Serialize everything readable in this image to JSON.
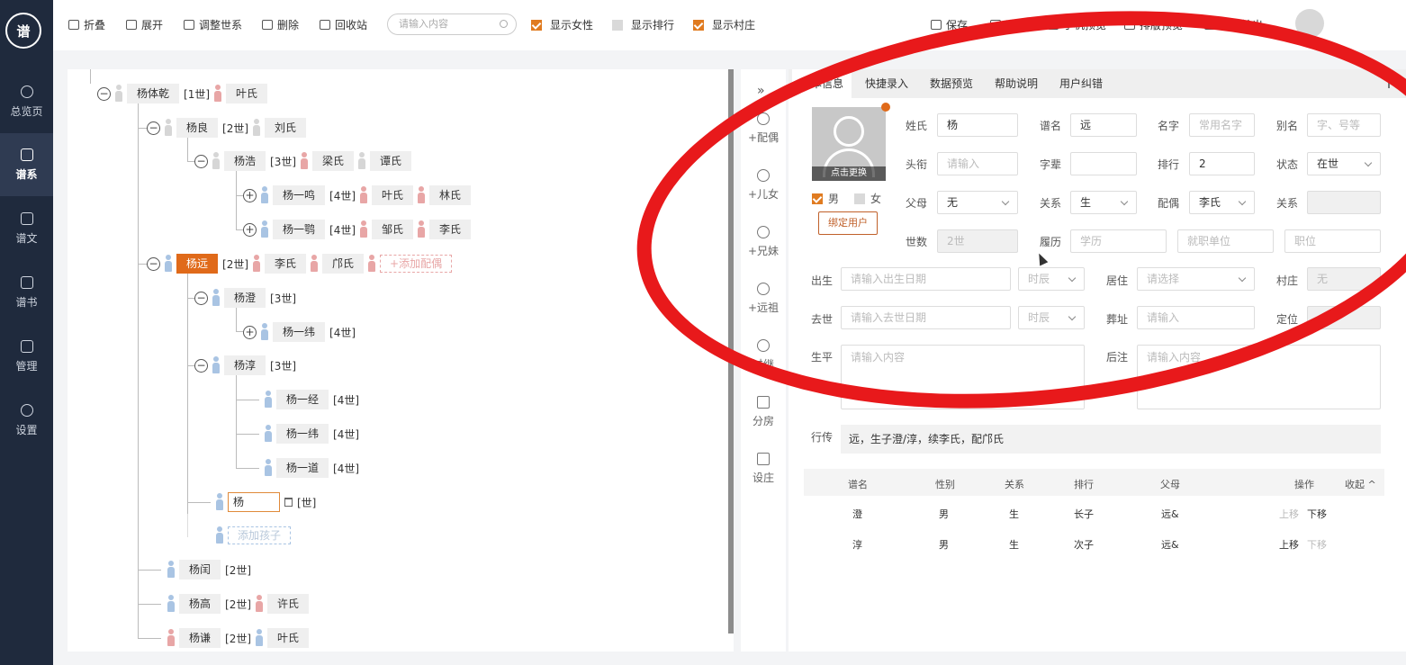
{
  "sidebar": {
    "logo": "谱",
    "items": [
      {
        "label": "总览页"
      },
      {
        "label": "谱系"
      },
      {
        "label": "谱文"
      },
      {
        "label": "谱书"
      },
      {
        "label": "管理"
      },
      {
        "label": "设置"
      }
    ]
  },
  "toolbar": {
    "collapse": "折叠",
    "expand": "展开",
    "adjust": "调整世系",
    "delete": "删除",
    "recycle": "回收站",
    "search_placeholder": "请输入内容",
    "show_female": "显示女性",
    "show_rank": "显示排行",
    "show_village": "显示村庄",
    "save": "保存",
    "font": "造字",
    "mobile_preview": "手机预览",
    "layout_preview": "排版预览",
    "export": "选版输出"
  },
  "tree": {
    "root": {
      "name": "杨体乾",
      "gen": "[1世]",
      "spouse": "叶氏"
    },
    "liang": {
      "name": "杨良",
      "gen": "[2世]",
      "spouse": "刘氏"
    },
    "hao": {
      "name": "杨浩",
      "gen": "[3世]",
      "spouse1": "梁氏",
      "spouse2": "谭氏"
    },
    "yiming": {
      "name": "杨一鸣",
      "gen": "[4世]",
      "spouse1": "叶氏",
      "spouse2": "林氏"
    },
    "yipeng": {
      "name": "杨一鹗",
      "gen": "[4世]",
      "spouse1": "邹氏",
      "spouse2": "李氏"
    },
    "yuan": {
      "name": "杨远",
      "gen": "[2世]",
      "spouse1": "李氏",
      "spouse2": "邝氏",
      "add_spouse": "+添加配偶"
    },
    "cheng": {
      "name": "杨澄",
      "gen": "[3世]"
    },
    "yiwei1": {
      "name": "杨一纬",
      "gen": "[4世]"
    },
    "chun": {
      "name": "杨淳",
      "gen": "[3世]"
    },
    "yijing": {
      "name": "杨一经",
      "gen": "[4世]"
    },
    "yiwei2": {
      "name": "杨一纬",
      "gen": "[4世]"
    },
    "yidao": {
      "name": "杨一道",
      "gen": "[4世]"
    },
    "new_child": {
      "value": "杨",
      "gen": "[世]"
    },
    "add_child": "添加孩子",
    "run": {
      "name": "杨闰",
      "gen": "[2世]"
    },
    "gao": {
      "name": "杨高",
      "gen": "[2世]",
      "spouse": "许氏"
    },
    "qian": {
      "name": "杨谦",
      "gen": "[2世]",
      "spouse": "叶氏"
    }
  },
  "mid_nav": [
    {
      "label": "+配偶"
    },
    {
      "label": "+儿女"
    },
    {
      "label": "+兄妹"
    },
    {
      "label": "+远祖"
    },
    {
      "label": "过继"
    },
    {
      "label": "分房"
    },
    {
      "label": "设庄"
    }
  ],
  "tabs": [
    "基本信息",
    "快捷录入",
    "数据预览",
    "帮助说明",
    "用户纠错"
  ],
  "form": {
    "photo_caption": "点击更换",
    "gender_male": "男",
    "gender_female": "女",
    "bind_user": "绑定用户",
    "surname_label": "姓氏",
    "surname": "杨",
    "puming_label": "谱名",
    "puming": "远",
    "mingzi_label": "名字",
    "mingzi_ph": "常用名字",
    "bieming_label": "别名",
    "bieming_ph": "字、号等",
    "touxian_label": "头衔",
    "touxian_ph": "请输入",
    "zibei_label": "字辈",
    "zibei": "",
    "paihang_label": "排行",
    "paihang": "2",
    "zhuangtai_label": "状态",
    "zhuangtai": "在世",
    "fumu_label": "父母",
    "fumu": "无",
    "guanxi_label": "关系",
    "guanxi": "生",
    "peiou_label": "配偶",
    "peiou": "李氏",
    "guanxi2_label": "关系",
    "shishu_label": "世数",
    "shishu": "2世",
    "luli_label": "履历",
    "xueli_ph": "学历",
    "danwei_ph": "就职单位",
    "zhiwei_ph": "职位",
    "chusheng_label": "出生",
    "chusheng_ph": "请输入出生日期",
    "shichen_ph": "时辰",
    "juzhu_label": "居住",
    "juzhu_ph": "请选择",
    "cunzhuang_label": "村庄",
    "cunzhuang": "无",
    "qushi_label": "去世",
    "qushi_ph": "请输入去世日期",
    "shichen2_ph": "时辰",
    "zangzhi_label": "葬址",
    "zangzhi_ph": "请输入",
    "dingwei_label": "定位",
    "shengping_label": "生平",
    "shengping_ph": "请输入内容",
    "houzhu_label": "后注",
    "houzhu_ph": "请输入内容",
    "xingzhuan_label": "行传",
    "xingzhuan": "远，生子澄/淳，续李氏，配邝氏"
  },
  "children_table": {
    "headers": [
      "谱名",
      "性别",
      "关系",
      "排行",
      "父母",
      "操作",
      "收起 ^"
    ],
    "rows": [
      {
        "name": "澄",
        "gender": "男",
        "rel": "生",
        "rank": "长子",
        "parents": "远&",
        "up": "上移",
        "down": "下移"
      },
      {
        "name": "淳",
        "gender": "男",
        "rel": "生",
        "rank": "次子",
        "parents": "远&",
        "up": "上移",
        "down": "下移"
      }
    ]
  },
  "colors": {
    "accent": "#e06a1a",
    "sidebar": "#1f2a3d",
    "annotation": "#e8191b"
  }
}
